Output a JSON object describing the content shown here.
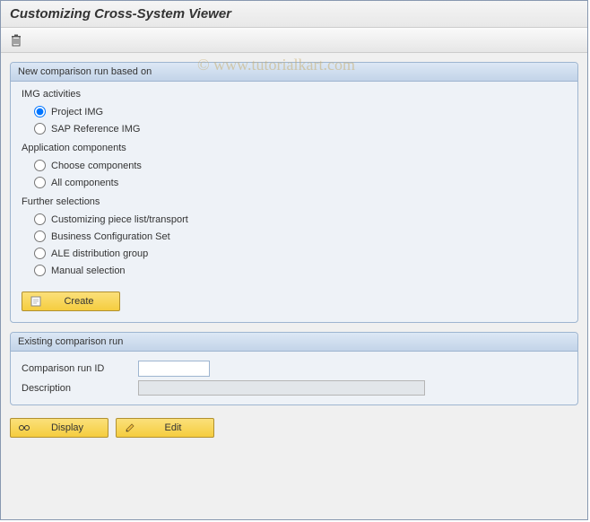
{
  "title": "Customizing Cross-System Viewer",
  "watermark": "© www.tutorialkart.com",
  "panel1": {
    "header": "New comparison run based on",
    "section1_label": "IMG activities",
    "radio_project_img": "Project IMG",
    "radio_sap_ref_img": "SAP Reference IMG",
    "section2_label": "Application components",
    "radio_choose_components": "Choose components",
    "radio_all_components": "All components",
    "section3_label": "Further selections",
    "radio_piece_list": "Customizing piece list/transport",
    "radio_bc_set": "Business Configuration Set",
    "radio_ale": "ALE distribution group",
    "radio_manual": "Manual selection",
    "btn_create": "Create"
  },
  "panel2": {
    "header": "Existing comparison run",
    "label_run_id": "Comparison run ID",
    "value_run_id": "",
    "label_description": "Description",
    "value_description": ""
  },
  "btn_display": "Display",
  "btn_edit": "Edit"
}
